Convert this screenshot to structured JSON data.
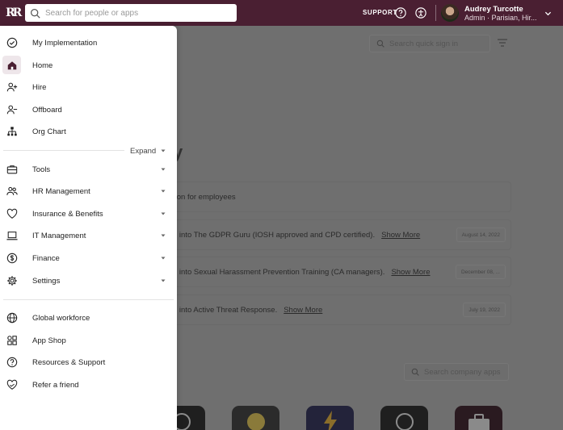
{
  "topbar": {
    "logo_text": "RR",
    "search_placeholder": "Search for people or apps",
    "support_label": "SUPPORT",
    "user_name": "Audrey Turcotte",
    "user_role": "Admin · Parisian, Hir..."
  },
  "background": {
    "quick_signin_placeholder": "Search quick sign in",
    "heading_fragment": "y",
    "cards": [
      {
        "text": "tion for employees",
        "more": "",
        "date": ""
      },
      {
        "text": "d into The GDPR Guru (IOSH approved and CPD certified).",
        "more": "Show More",
        "date": "August 14, 2022"
      },
      {
        "text": "d into Sexual Harassment Prevention Training (CA managers).",
        "more": "Show More",
        "date": "December 08, ..."
      },
      {
        "text": "d into Active Threat Response.",
        "more": "Show More",
        "date": "July 19, 2022"
      }
    ],
    "company_apps_placeholder": "Search company apps"
  },
  "sidebar": {
    "top_items": [
      {
        "label": "My Implementation",
        "icon": "check-circle-icon"
      },
      {
        "label": "Home",
        "icon": "home-icon"
      },
      {
        "label": "Hire",
        "icon": "user-plus-icon"
      },
      {
        "label": "Offboard",
        "icon": "user-minus-icon"
      },
      {
        "label": "Org Chart",
        "icon": "org-chart-icon"
      }
    ],
    "expand_label": "Expand",
    "group_items": [
      {
        "label": "Tools",
        "icon": "toolbox-icon"
      },
      {
        "label": "HR Management",
        "icon": "people-icon"
      },
      {
        "label": "Insurance & Benefits",
        "icon": "heart-icon"
      },
      {
        "label": "IT Management",
        "icon": "laptop-icon"
      },
      {
        "label": "Finance",
        "icon": "dollar-icon"
      },
      {
        "label": "Settings",
        "icon": "gear-icon"
      }
    ],
    "bottom_items": [
      {
        "label": "Global workforce",
        "icon": "globe-icon"
      },
      {
        "label": "App Shop",
        "icon": "app-shop-icon"
      },
      {
        "label": "Resources & Support",
        "icon": "question-icon"
      },
      {
        "label": "Refer a friend",
        "icon": "refer-heart-icon"
      }
    ]
  }
}
